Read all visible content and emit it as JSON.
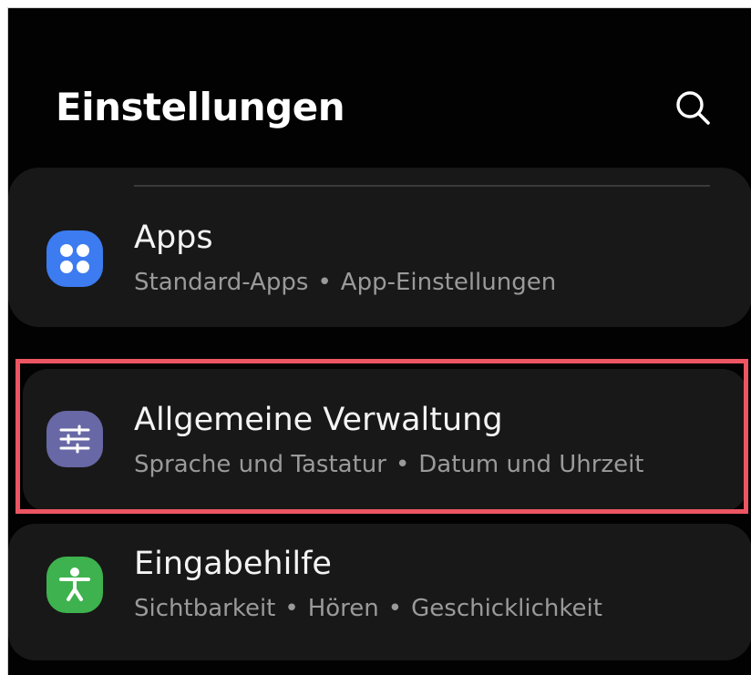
{
  "header": {
    "title": "Einstellungen",
    "search_icon": "search-icon"
  },
  "items": [
    {
      "title": "Apps",
      "subtitle_parts": [
        "Standard-Apps",
        "App-Einstellungen"
      ],
      "icon": "apps-grid-icon",
      "icon_color": "#3c7bf0"
    },
    {
      "title": "Allgemeine Verwaltung",
      "subtitle_parts": [
        "Sprache und Tastatur",
        "Datum und Uhrzeit"
      ],
      "icon": "sliders-icon",
      "icon_color": "#6868a6",
      "highlighted": true
    },
    {
      "title": "Eingabehilfe",
      "subtitle_parts": [
        "Sichtbarkeit",
        "Hören",
        "Geschicklichkeit"
      ],
      "icon": "accessibility-icon",
      "icon_color": "#3eb24e"
    }
  ],
  "separator": "•",
  "colors": {
    "background": "#020202",
    "card": "#181818",
    "highlight": "#ec5562"
  }
}
